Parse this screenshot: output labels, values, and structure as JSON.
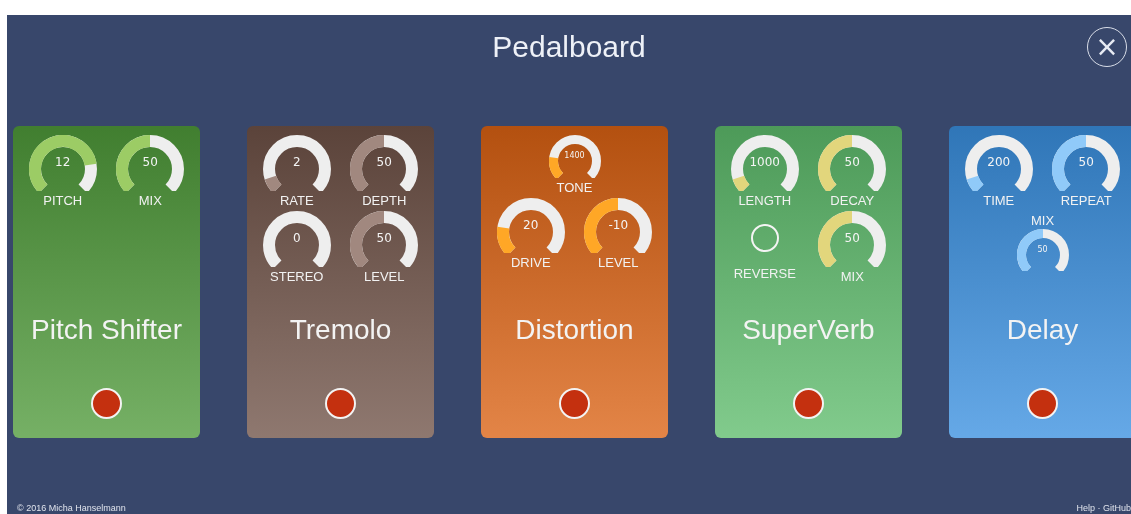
{
  "header": {
    "title": "Pedalboard",
    "close": "×"
  },
  "pedals": [
    {
      "name": "Pitch Shifter",
      "rows": [
        [
          {
            "kind": "knob",
            "label": "PITCH",
            "value": "12"
          },
          {
            "kind": "knob",
            "label": "MIX",
            "value": "50"
          }
        ]
      ]
    },
    {
      "name": "Tremolo",
      "rows": [
        [
          {
            "kind": "knob",
            "label": "RATE",
            "value": "2"
          },
          {
            "kind": "knob",
            "label": "DEPTH",
            "value": "50"
          }
        ],
        [
          {
            "kind": "knob",
            "label": "STEREO",
            "value": "0"
          },
          {
            "kind": "knob",
            "label": "LEVEL",
            "value": "50"
          }
        ]
      ]
    },
    {
      "name": "Distortion",
      "rows": [
        [
          {
            "kind": "mini",
            "label": "TONE",
            "value": "1400"
          }
        ],
        [
          {
            "kind": "knob",
            "label": "DRIVE",
            "value": "20"
          },
          {
            "kind": "knob",
            "label": "LEVEL",
            "value": "-10"
          }
        ]
      ]
    },
    {
      "name": "SuperVerb",
      "rows": [
        [
          {
            "kind": "knob",
            "label": "LENGTH",
            "value": "1000"
          },
          {
            "kind": "knob",
            "label": "DECAY",
            "value": "50"
          }
        ],
        [
          {
            "kind": "toggle",
            "label": "REVERSE",
            "checked": false
          },
          {
            "kind": "knob",
            "label": "MIX",
            "value": "50"
          }
        ]
      ]
    },
    {
      "name": "Delay",
      "rows": [
        [
          {
            "kind": "knob",
            "label": "TIME",
            "value": "200"
          },
          {
            "kind": "knob",
            "label": "REPEAT",
            "value": "50"
          }
        ],
        [
          {
            "kind": "topmini",
            "label": "MIX",
            "value": "50"
          }
        ]
      ]
    }
  ],
  "footer": {
    "credit": "© 2016 Micha Hanselmann",
    "links": "Help · GitHub"
  }
}
